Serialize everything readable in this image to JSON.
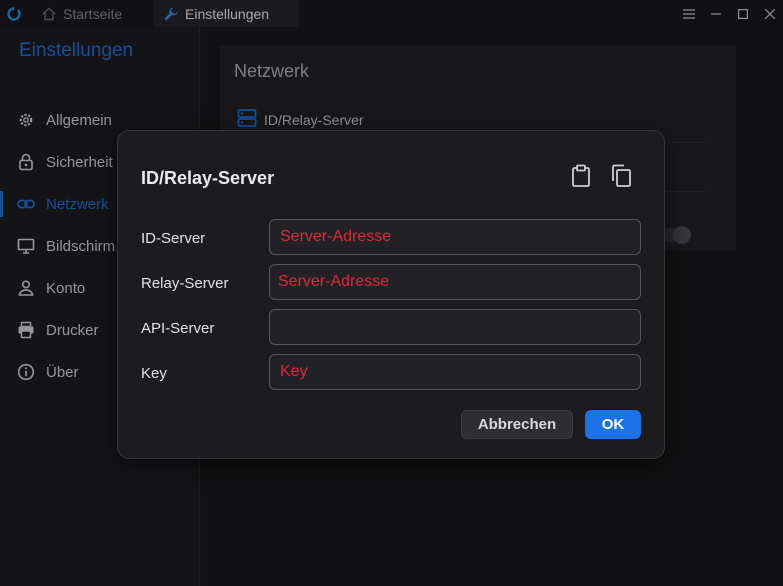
{
  "titlebar": {
    "tabs": [
      {
        "label": "Startseite",
        "icon": "home-icon",
        "active": false
      },
      {
        "label": "Einstellungen",
        "icon": "wrench-icon",
        "active": true
      }
    ],
    "controls": [
      "menu-icon",
      "minimize-icon",
      "maximize-icon",
      "close-icon"
    ]
  },
  "sidebar": {
    "title": "Einstellungen",
    "items": [
      {
        "label": "Allgemein",
        "icon": "gear-icon"
      },
      {
        "label": "Sicherheit",
        "icon": "lock-icon"
      },
      {
        "label": "Netzwerk",
        "icon": "link-icon",
        "active": true
      },
      {
        "label": "Bildschirm",
        "icon": "monitor-icon"
      },
      {
        "label": "Konto",
        "icon": "user-icon"
      },
      {
        "label": "Drucker",
        "icon": "printer-icon"
      },
      {
        "label": "Über",
        "icon": "info-icon"
      }
    ]
  },
  "main": {
    "card_title": "Netzwerk",
    "row_label": "ID/Relay-Server"
  },
  "dialog": {
    "title": "ID/Relay-Server",
    "fields": [
      {
        "label": "ID-Server",
        "value": "",
        "placeholder": "Server-Adresse"
      },
      {
        "label": "Relay-Server",
        "value": "",
        "placeholder": "Server-Adresse"
      },
      {
        "label": "API-Server",
        "value": "",
        "placeholder": ""
      },
      {
        "label": "Key",
        "value": "",
        "placeholder": "Key"
      }
    ],
    "cancel_label": "Abbrechen",
    "ok_label": "OK"
  },
  "colors": {
    "accent": "#1a73e8",
    "sidebar_accent": "#1c6fd6",
    "placeholder": "#e0283a",
    "background": "#18181b"
  }
}
